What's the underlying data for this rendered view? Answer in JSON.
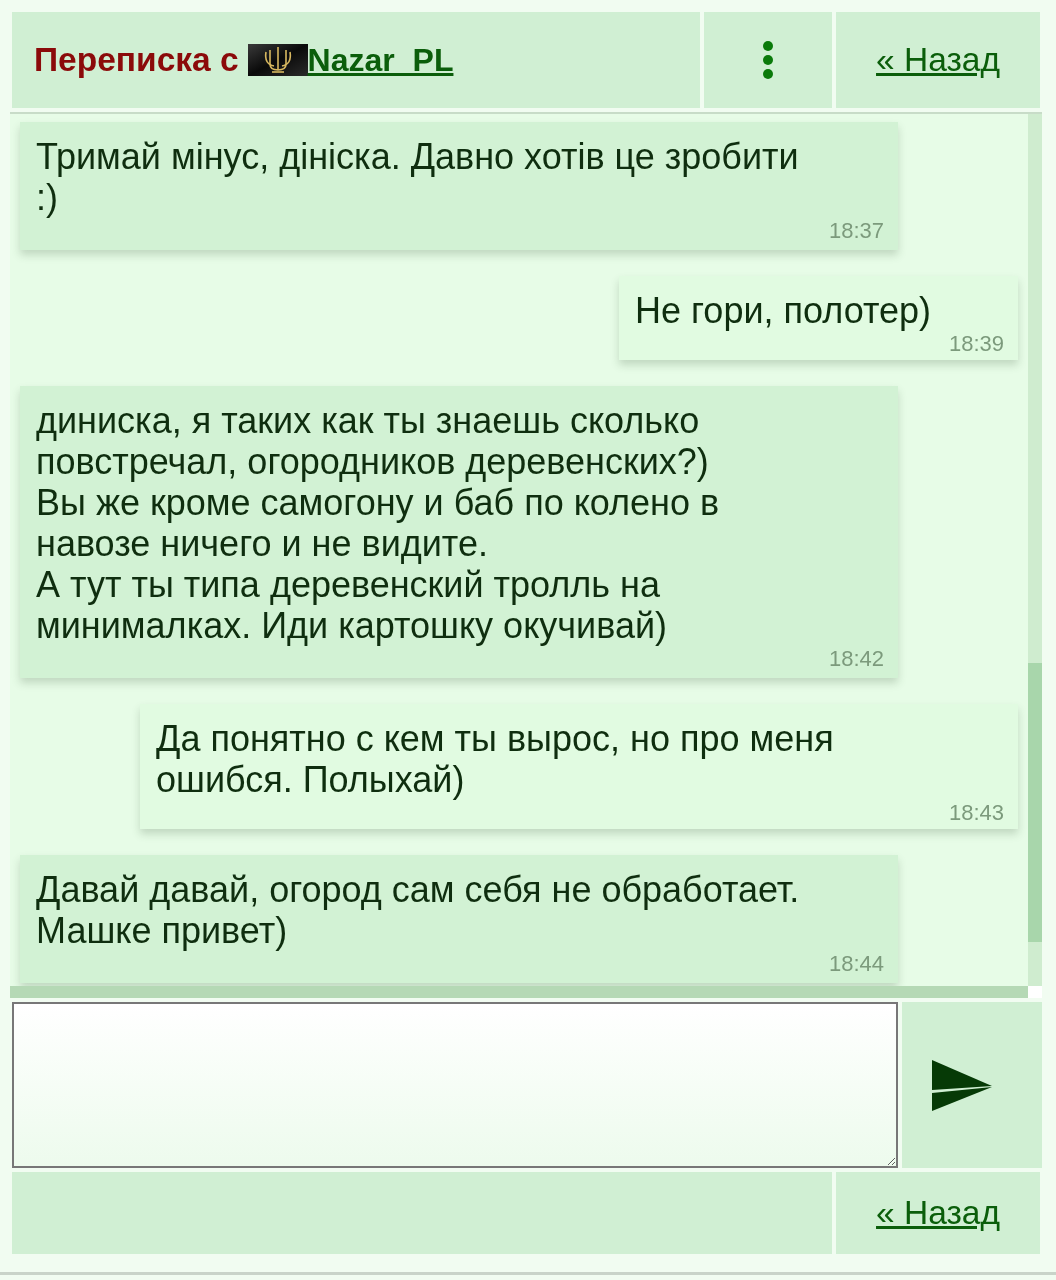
{
  "header": {
    "title": "Переписка с",
    "contact": "Nazar_PL",
    "back_link": "« Назад"
  },
  "messages": [
    {
      "kind": "incoming",
      "text": "Тримай мінус, дініска. Давно хотів це зробити :)",
      "time": "18:37"
    },
    {
      "kind": "outgoing",
      "text": "Не гори, полотер)",
      "time": "18:39"
    },
    {
      "kind": "incoming",
      "text": "диниска, я таких как ты знаешь сколько повстречал, огородников деревенских?)\nВы же кроме самогону и баб по колено в навозе ничего и не видите.\nА тут ты типа деревенский тролль на минималках. Иди картошку окучивай)",
      "time": "18:42"
    },
    {
      "kind": "outgoing",
      "text": "Да понятно с кем ты вырос, но про меня ошибся. Полыхай)",
      "time": "18:43"
    },
    {
      "kind": "incoming",
      "text": "Давай давай, огород сам себя не обработает. Машке привет)",
      "time": "18:44"
    }
  ],
  "footer": {
    "back_link": "« Назад"
  }
}
